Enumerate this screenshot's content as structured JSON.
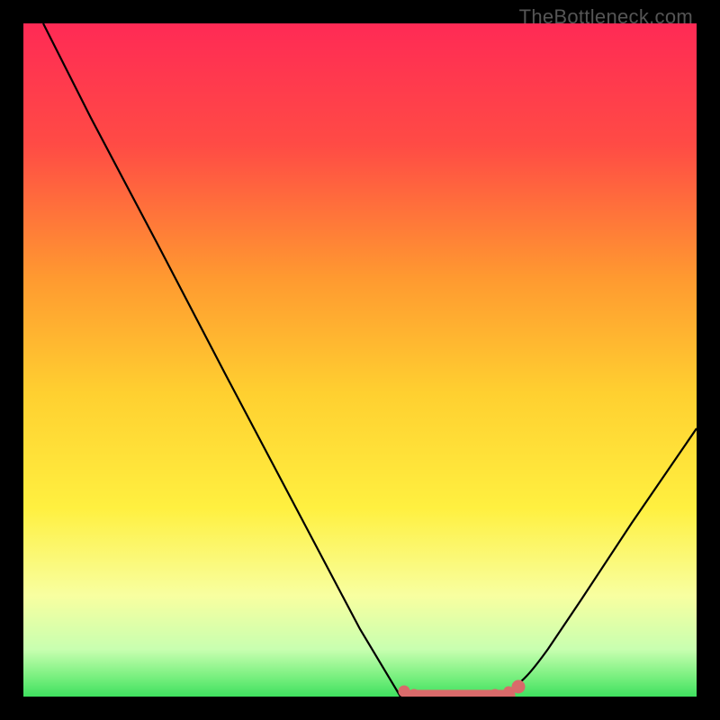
{
  "watermark": "TheBottleneck.com",
  "chart_data": {
    "type": "line",
    "title": "",
    "xlabel": "",
    "ylabel": "",
    "series": [
      {
        "name": "bottleneck-curve",
        "x": [
          0.03,
          0.1,
          0.2,
          0.3,
          0.4,
          0.5,
          0.56,
          0.6,
          0.63,
          0.66,
          0.7,
          0.74,
          0.78,
          0.85,
          0.92,
          1.0
        ],
        "y": [
          1.0,
          0.86,
          0.67,
          0.48,
          0.29,
          0.1,
          0.0,
          0.0,
          0.0,
          0.0,
          0.0,
          0.0,
          0.02,
          0.1,
          0.22,
          0.38
        ],
        "color": "#000000"
      },
      {
        "name": "optimal-range-markers",
        "x": [
          0.565,
          0.58,
          0.6,
          0.62,
          0.64,
          0.66,
          0.68,
          0.7,
          0.72,
          0.735
        ],
        "y": [
          0.008,
          0.0,
          0.0,
          0.0,
          0.0,
          0.0,
          0.0,
          0.0,
          0.0,
          0.012
        ],
        "color": "#d96a6a"
      }
    ],
    "xlim": [
      0,
      1
    ],
    "ylim": [
      0,
      1
    ],
    "background_gradient": {
      "top": "#ff2a55",
      "upper_mid": "#ffb030",
      "mid": "#ffe030",
      "lower_mid": "#f8ff60",
      "bottom": "#3fe05f"
    }
  }
}
